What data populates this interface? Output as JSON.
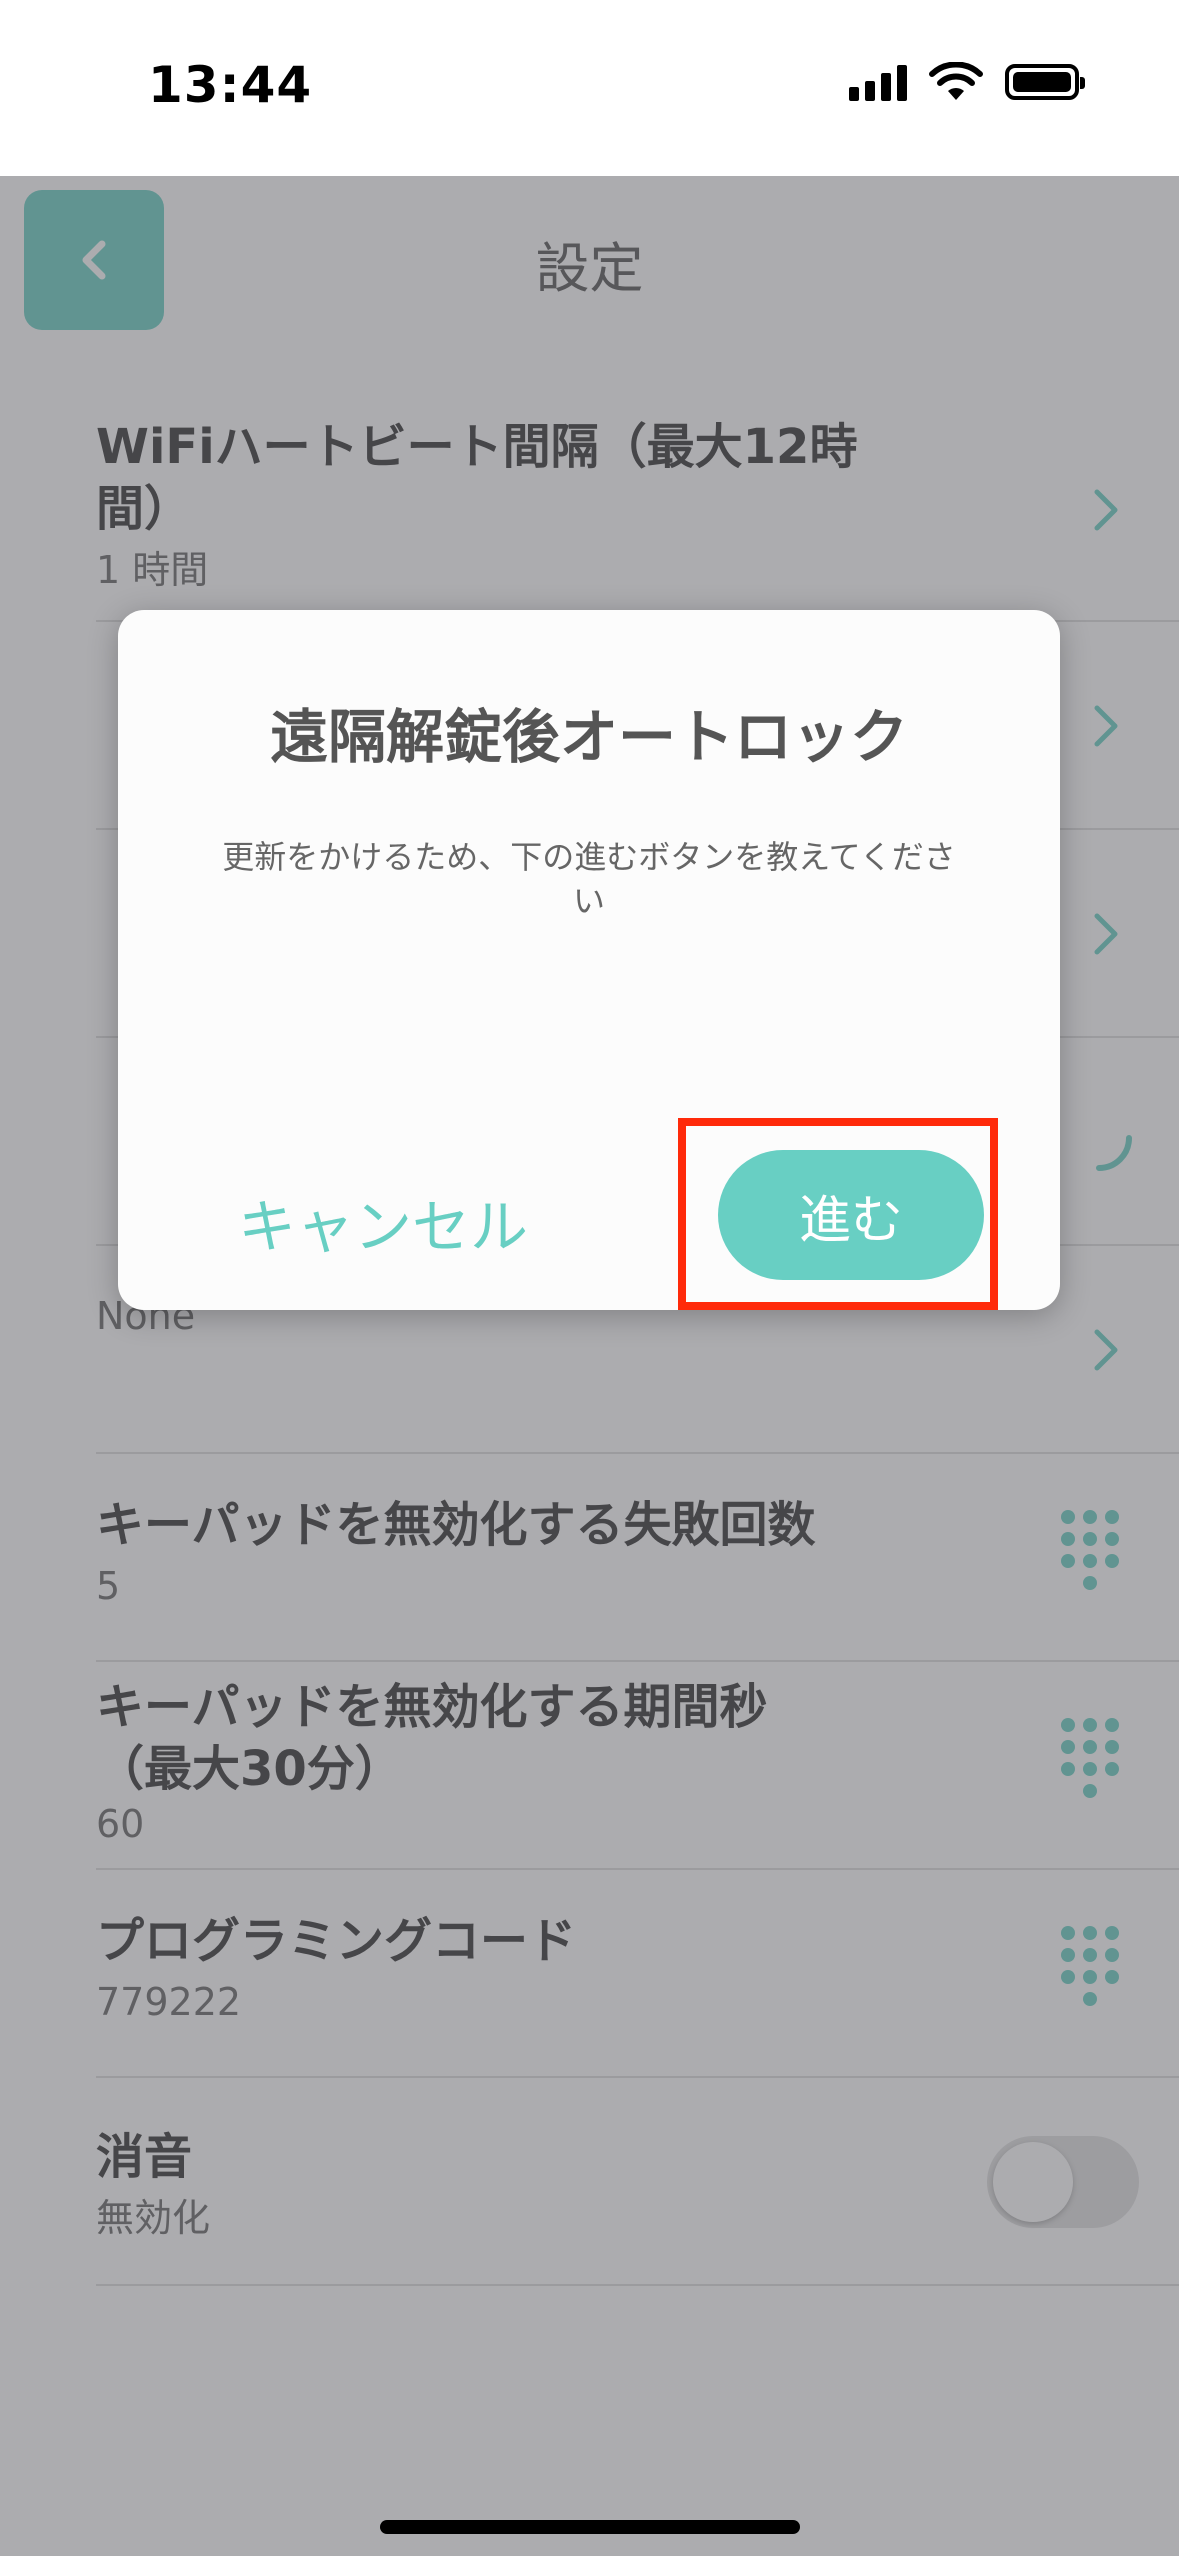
{
  "status_bar": {
    "time": "13:44"
  },
  "header": {
    "title": "設定",
    "back_icon": "chevron-left-icon"
  },
  "settings": [
    {
      "title": "WiFiハートビート間隔（最大12時間）",
      "value": "1 時間",
      "accessory": "chevron"
    },
    {
      "title": "",
      "value": "",
      "accessory": "chevron"
    },
    {
      "title": "",
      "value": "",
      "accessory": "chevron"
    },
    {
      "title": "",
      "value": "",
      "accessory": "toggle"
    },
    {
      "title": "",
      "value": "None",
      "accessory": "chevron"
    },
    {
      "title": "キーパッドを無効化する失敗回数",
      "value": "5",
      "accessory": "keypad"
    },
    {
      "title": "キーパッドを無効化する期間秒（最大30分）",
      "value": "60",
      "accessory": "keypad"
    },
    {
      "title": "プログラミングコード",
      "value": "779222",
      "accessory": "keypad"
    },
    {
      "title": "消音",
      "value": "無効化",
      "accessory": "toggle"
    }
  ],
  "dialog": {
    "title": "遠隔解錠後オートロック",
    "message": "更新をかけるため、下の進むボタンを教えてください",
    "cancel_label": "キャンセル",
    "next_label": "進む"
  },
  "colors": {
    "accent": "#68cfc3",
    "highlight": "#ff2a0a",
    "overlay": "#5a5a5f"
  }
}
